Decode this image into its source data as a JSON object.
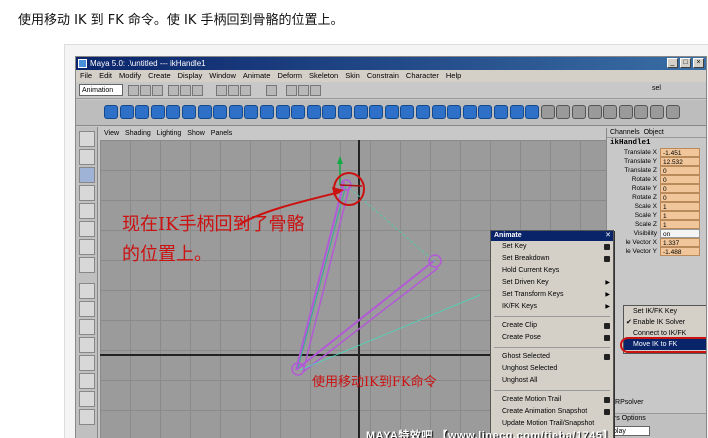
{
  "caption": "使用移动 IK 到 FK 命令。使 IK 手柄回到骨骼的位置上。",
  "window": {
    "title": "Maya 5.0: .\\untitled  ---  ikHandle1",
    "minimize": "_",
    "maximize": "□",
    "close": "×"
  },
  "menubar": [
    "File",
    "Edit",
    "Modify",
    "Create",
    "Display",
    "Window",
    "Animate",
    "Deform",
    "Skeleton",
    "Skin",
    "Constrain",
    "Character",
    "Help"
  ],
  "statusline": {
    "mode": "Animation",
    "sel_label": "sel"
  },
  "panel_menu": [
    "View",
    "Shading",
    "Lighting",
    "Show",
    "Panels"
  ],
  "annotations": {
    "line1": "现在IK手柄回到了骨骼",
    "line2": "的位置上。",
    "command": "使用移动IK到FK命令"
  },
  "channel_box": {
    "tabs": [
      "Channels",
      "Object"
    ],
    "node": "ikHandle1",
    "rows": [
      {
        "label": "Translate X",
        "value": "-1.451"
      },
      {
        "label": "Translate Y",
        "value": "12.532"
      },
      {
        "label": "Translate Z",
        "value": "0"
      },
      {
        "label": "Rotate X",
        "value": "0"
      },
      {
        "label": "Rotate Y",
        "value": "0"
      },
      {
        "label": "Rotate Z",
        "value": "0"
      },
      {
        "label": "Scale X",
        "value": "1"
      },
      {
        "label": "Scale Y",
        "value": "1"
      },
      {
        "label": "Scale Z",
        "value": "1"
      },
      {
        "label": "Visibility",
        "value": "on"
      },
      {
        "label": "le Vector X",
        "value": "1.337"
      },
      {
        "label": "le Vector Y",
        "value": "-1.488"
      }
    ],
    "solver_label": "ikRPsolver",
    "layer_tabs": "ers  Options",
    "layer_select": "play"
  },
  "animate_menu": {
    "title": "Animate",
    "items": [
      {
        "label": "Set Key",
        "option": true
      },
      {
        "label": "Set Breakdown",
        "option": true
      },
      {
        "label": "Hold Current Keys"
      },
      {
        "label": "Set Driven Key",
        "arrow": true
      },
      {
        "label": "Set Transform Keys",
        "arrow": true
      },
      {
        "label": "IK/FK Keys",
        "arrow": true
      },
      {
        "sep": true
      },
      {
        "label": "Create Clip",
        "option": true
      },
      {
        "label": "Create Pose",
        "option": true
      },
      {
        "sep": true
      },
      {
        "label": "Ghost Selected",
        "option": true
      },
      {
        "label": "Unghost Selected"
      },
      {
        "label": "Unghost All"
      },
      {
        "sep": true
      },
      {
        "label": "Create Motion Trail",
        "option": true
      },
      {
        "label": "Create Animation Snapshot",
        "option": true
      },
      {
        "label": "Update Motion Trail/Snapshot"
      }
    ]
  },
  "ikfk_submenu": {
    "items": [
      {
        "label": "Set IK/FK Key",
        "checked": false
      },
      {
        "label": "Enable IK Solver",
        "checked": true
      },
      {
        "label": "Connect to IK/FK",
        "checked": false
      },
      {
        "label": "Move IK to FK",
        "checked": false,
        "highlight": true
      }
    ]
  },
  "watermark": "MAYA特效吧  【www.linecg.com/tieba/1745】"
}
